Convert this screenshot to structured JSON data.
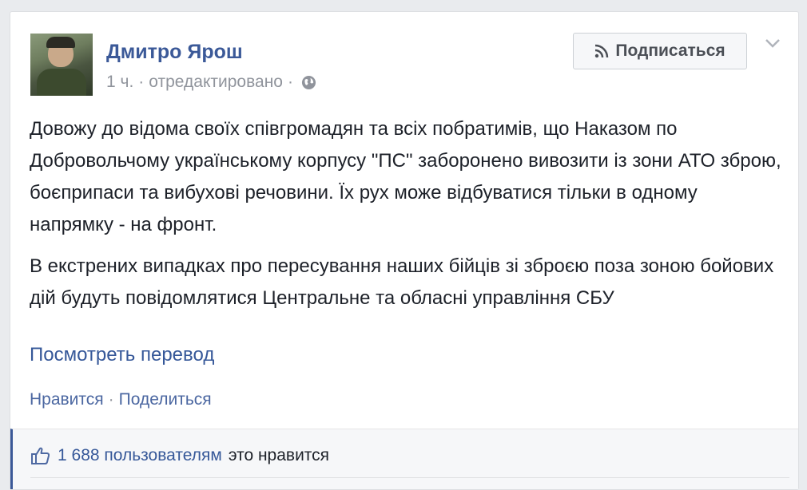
{
  "post": {
    "author": "Дмитро Ярош",
    "time": "1 ч.",
    "edited": "отредактировано",
    "separator": "·",
    "globe_icon": "globe-icon",
    "follow_label": "Подписаться",
    "follow_icon": "rss-icon",
    "menu_icon": "chevron-down-icon",
    "paragraphs": [
      "Довожу до відома своїх співгромадян та всіх побратимів, що Наказом по Добровольчому українському корпусу \"ПС\" заборонено вивозити із зони АТО зброю, боєприпаси та вибухові речовини. Їх рух може відбуватися тільки в одному напрямку - на фронт.",
      "В екстрених випадках про пересування наших бійців зі зброєю поза зоною бойових дій будуть повідомлятися Центральне та обласні управління СБУ"
    ],
    "translate_link": "Посмотреть перевод",
    "actions": {
      "like": "Нравится",
      "separator": "·",
      "share": "Поделиться"
    },
    "likes": {
      "icon": "thumbs-up-icon",
      "count_text": "1 688 пользователям",
      "suffix": "это нравится"
    }
  },
  "colors": {
    "link": "#3b5998",
    "text": "#1d2129",
    "meta": "#90949c"
  }
}
